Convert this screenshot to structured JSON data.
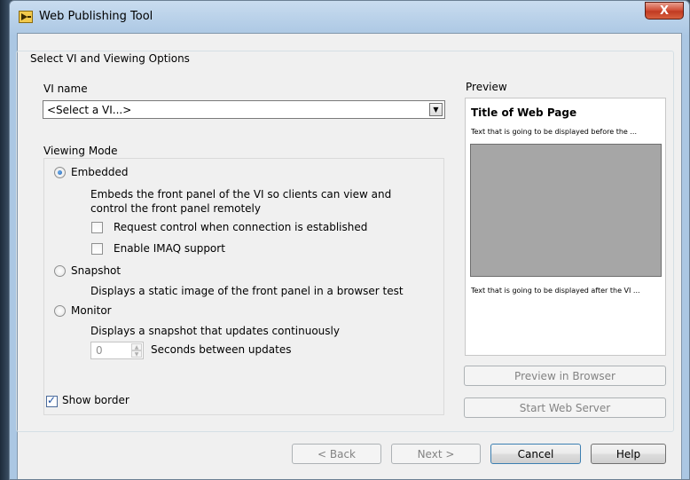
{
  "window": {
    "title": "Web Publishing Tool",
    "close_glyph": "X"
  },
  "group": {
    "legend": "Select VI and Viewing Options"
  },
  "vi_name": {
    "label": "VI name",
    "selected": "<Select a VI...>"
  },
  "viewing_mode": {
    "label": "Viewing Mode",
    "embedded": {
      "label": "Embedded",
      "checked": true,
      "description": "Embeds the front panel of the VI so clients can view and control the front panel remotely"
    },
    "request_control": {
      "label": "Request control when connection is established",
      "checked": false
    },
    "enable_imaq": {
      "label": "Enable IMAQ support",
      "checked": false
    },
    "snapshot": {
      "label": "Snapshot",
      "checked": false,
      "description": "Displays a static image of the front panel in a browser test"
    },
    "monitor": {
      "label": "Monitor",
      "checked": false,
      "description": "Displays a snapshot that updates continuously"
    },
    "seconds": {
      "value": "0",
      "label": "Seconds between updates"
    }
  },
  "show_border": {
    "label": "Show border",
    "checked": true
  },
  "preview": {
    "label": "Preview",
    "title": "Title of Web Page",
    "before_text": "Text that is going to be displayed before the ...",
    "after_text": "Text that is going to be displayed after the VI ...",
    "preview_in_browser": "Preview in Browser",
    "start_web_server": "Start Web Server"
  },
  "footer": {
    "back": "< Back",
    "next": "Next >",
    "cancel": "Cancel",
    "help": "Help"
  },
  "colors": {
    "title_gradient_top": "#c9dcef",
    "close_red": "#c13a22",
    "dialog_bg": "#f0f0f0",
    "preview_gray": "#a6a6a6",
    "accent_blue": "#1f5fb0"
  }
}
